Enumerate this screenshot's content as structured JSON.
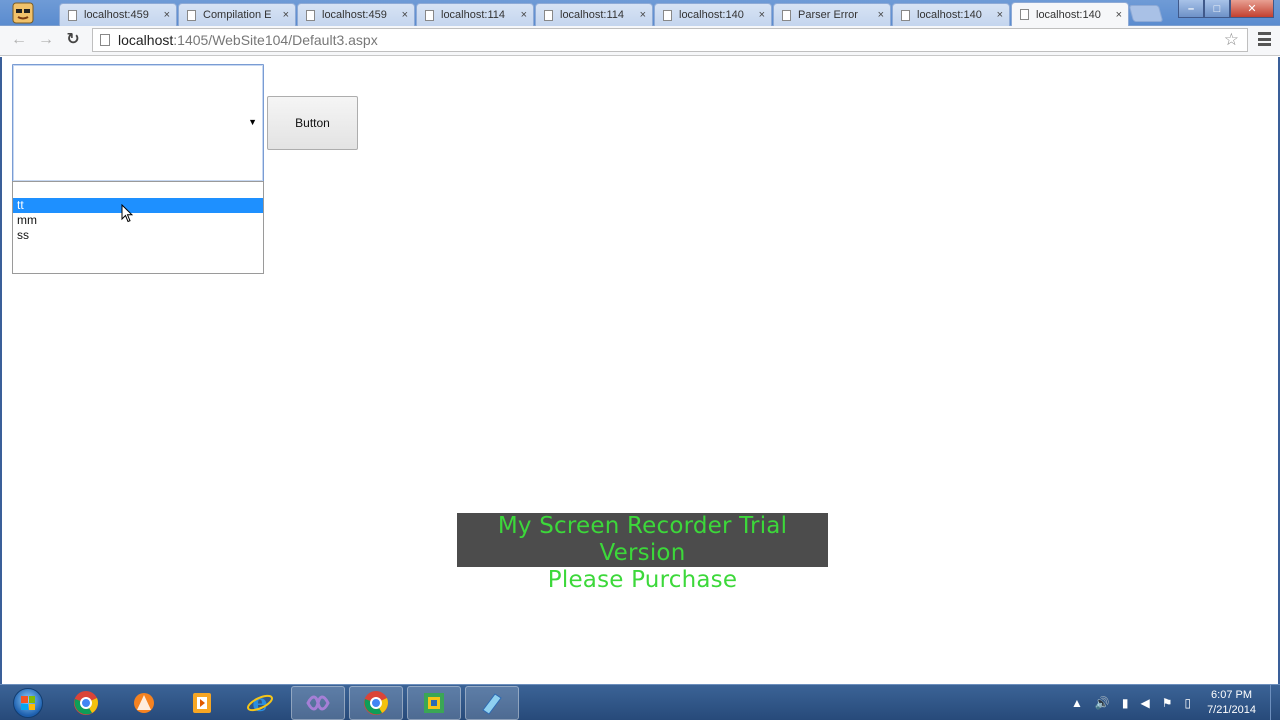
{
  "browser": {
    "tabs": [
      {
        "label": "localhost:459",
        "active": false
      },
      {
        "label": "Compilation E",
        "active": false
      },
      {
        "label": "localhost:459",
        "active": false
      },
      {
        "label": "localhost:114",
        "active": false
      },
      {
        "label": "localhost:114",
        "active": false
      },
      {
        "label": "localhost:140",
        "active": false
      },
      {
        "label": "Parser Error",
        "active": false
      },
      {
        "label": "localhost:140",
        "active": false
      },
      {
        "label": "localhost:140",
        "active": true
      }
    ],
    "tab_close_glyph": "×",
    "url_host": "localhost",
    "url_path": ":1405/WebSite104/Default3.aspx",
    "nav": {
      "back": "←",
      "forward": "→",
      "reload": "↻"
    },
    "star_glyph": "☆",
    "window_controls": {
      "minimize": "–",
      "maximize": "□",
      "close": "✕"
    }
  },
  "page": {
    "select_arrow": "▼",
    "options": [
      {
        "label": "tt",
        "selected": true
      },
      {
        "label": "mm",
        "selected": false
      },
      {
        "label": "ss",
        "selected": false
      }
    ],
    "button_label": "Button",
    "watermark_line1": "My Screen Recorder Trial Version",
    "watermark_line2": "Please Purchase"
  },
  "taskbar": {
    "pinned": [
      "chrome-icon",
      "avast-icon",
      "media-player-icon",
      "internet-explorer-icon",
      "visual-studio-icon",
      "chrome-icon",
      "app-icon",
      "app-icon"
    ],
    "clock_time": "6:07 PM",
    "clock_date": "7/21/2014"
  },
  "colors": {
    "selection": "#1e90ff",
    "watermark_text": "#3cd83a",
    "watermark_bg": "#4c4c4c",
    "taskbar": "#2d5286"
  }
}
